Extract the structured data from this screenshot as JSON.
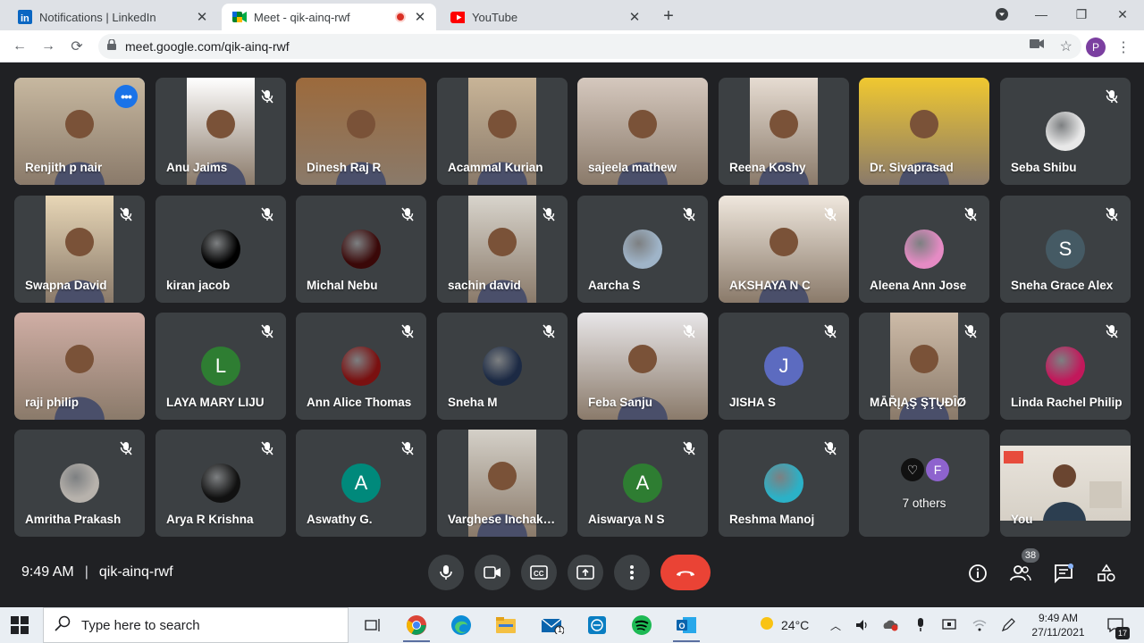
{
  "browser": {
    "tabs": [
      {
        "title": "Notifications | LinkedIn",
        "icon": "linkedin-icon",
        "active": false
      },
      {
        "title": "Meet - qik-ainq-rwf",
        "icon": "google-meet-icon",
        "active": true
      },
      {
        "title": "YouTube",
        "icon": "youtube-icon",
        "active": false
      }
    ],
    "url": "meet.google.com/qik-ainq-rwf",
    "profile_initial": "P"
  },
  "participants": [
    {
      "name": "Renjith p nair",
      "type": "video",
      "color": "#c7b8a0",
      "muted": false,
      "selected": true
    },
    {
      "name": "Anu Jaims",
      "type": "video",
      "color": "#ffffff",
      "muted": true
    },
    {
      "name": "Dinesh Raj R",
      "type": "video",
      "color": "#9c6a3c",
      "muted": false
    },
    {
      "name": "Acammal Kurian",
      "type": "video",
      "color": "#c8b497",
      "muted": false
    },
    {
      "name": "sajeela mathew",
      "type": "video",
      "color": "#d5c8be",
      "muted": false
    },
    {
      "name": "Reena Koshy",
      "type": "video",
      "color": "#e6dcd2",
      "muted": false
    },
    {
      "name": "Dr. Sivaprasad",
      "type": "video",
      "color": "#f0c830",
      "muted": false
    },
    {
      "name": "Seba Shibu",
      "type": "avatar-image",
      "color": "#e8e8e8",
      "muted": true
    },
    {
      "name": "Swapna David",
      "type": "video",
      "color": "#e7d6b6",
      "muted": true
    },
    {
      "name": "kiran jacob",
      "type": "avatar-image",
      "color": "#000000",
      "muted": true
    },
    {
      "name": "Michal Nebu",
      "type": "avatar-image",
      "color": "#3a0808",
      "muted": true
    },
    {
      "name": "sachin david",
      "type": "video",
      "color": "#d8d4cc",
      "muted": true
    },
    {
      "name": "Aarcha S",
      "type": "avatar-image",
      "color": "#9fb4c8",
      "muted": true
    },
    {
      "name": "AKSHAYA N C",
      "type": "video",
      "color": "#efe7dd",
      "muted": true
    },
    {
      "name": "Aleena Ann Jose",
      "type": "avatar-image",
      "color": "#e58bc4",
      "muted": true
    },
    {
      "name": "Sneha Grace Alex",
      "type": "initial",
      "initial": "S",
      "color": "#455a64",
      "muted": true
    },
    {
      "name": "raji philip",
      "type": "video",
      "color": "#d0aea5",
      "muted": false
    },
    {
      "name": "LAYA MARY LIJU",
      "type": "initial",
      "initial": "L",
      "color": "#2e7d32",
      "muted": true
    },
    {
      "name": "Ann Alice Thomas",
      "type": "avatar-image",
      "color": "#7a1010",
      "muted": true
    },
    {
      "name": "Sneha M",
      "type": "avatar-image",
      "color": "#1c2a44",
      "muted": true
    },
    {
      "name": "Feba Sanju",
      "type": "video",
      "color": "#e8e6e8",
      "muted": true
    },
    {
      "name": "JISHA S",
      "type": "initial",
      "initial": "J",
      "color": "#5c6bc0",
      "muted": true
    },
    {
      "name": "MĀŘĮĄŞ ŞŢŲĐÎØ",
      "type": "video",
      "color": "#cdbba8",
      "muted": true
    },
    {
      "name": "Linda Rachel Philip",
      "type": "avatar-image",
      "color": "#c2185b",
      "muted": true
    },
    {
      "name": "Amritha Prakash",
      "type": "avatar-image",
      "color": "#b7b2ac",
      "muted": true
    },
    {
      "name": "Arya R Krishna",
      "type": "avatar-image",
      "color": "#111111",
      "muted": true
    },
    {
      "name": "Aswathy G.",
      "type": "initial",
      "initial": "A",
      "color": "#00897b",
      "muted": true
    },
    {
      "name": "Varghese Inchakkalody",
      "type": "video",
      "color": "#d4d0c8",
      "muted": false
    },
    {
      "name": "Aiswarya N S",
      "type": "initial",
      "initial": "A",
      "color": "#2e7d32",
      "muted": true
    },
    {
      "name": "Reshma Manoj",
      "type": "avatar-image",
      "color": "#2bb1c7",
      "muted": true
    },
    {
      "name": "7 others",
      "type": "others",
      "initial": "F",
      "color": "#8e63ce",
      "muted": false
    },
    {
      "name": "You",
      "type": "self-video",
      "color": "#e9e4dc",
      "muted": false
    }
  ],
  "controls": {
    "time": "9:49 AM",
    "meeting_code": "qik-ainq-rwf",
    "people_count": "38"
  },
  "taskbar": {
    "search_placeholder": "Type here to search",
    "temperature": "24°C",
    "time": "9:49 AM",
    "date": "27/11/2021",
    "mail_badge": "1",
    "notif_count": "17"
  }
}
